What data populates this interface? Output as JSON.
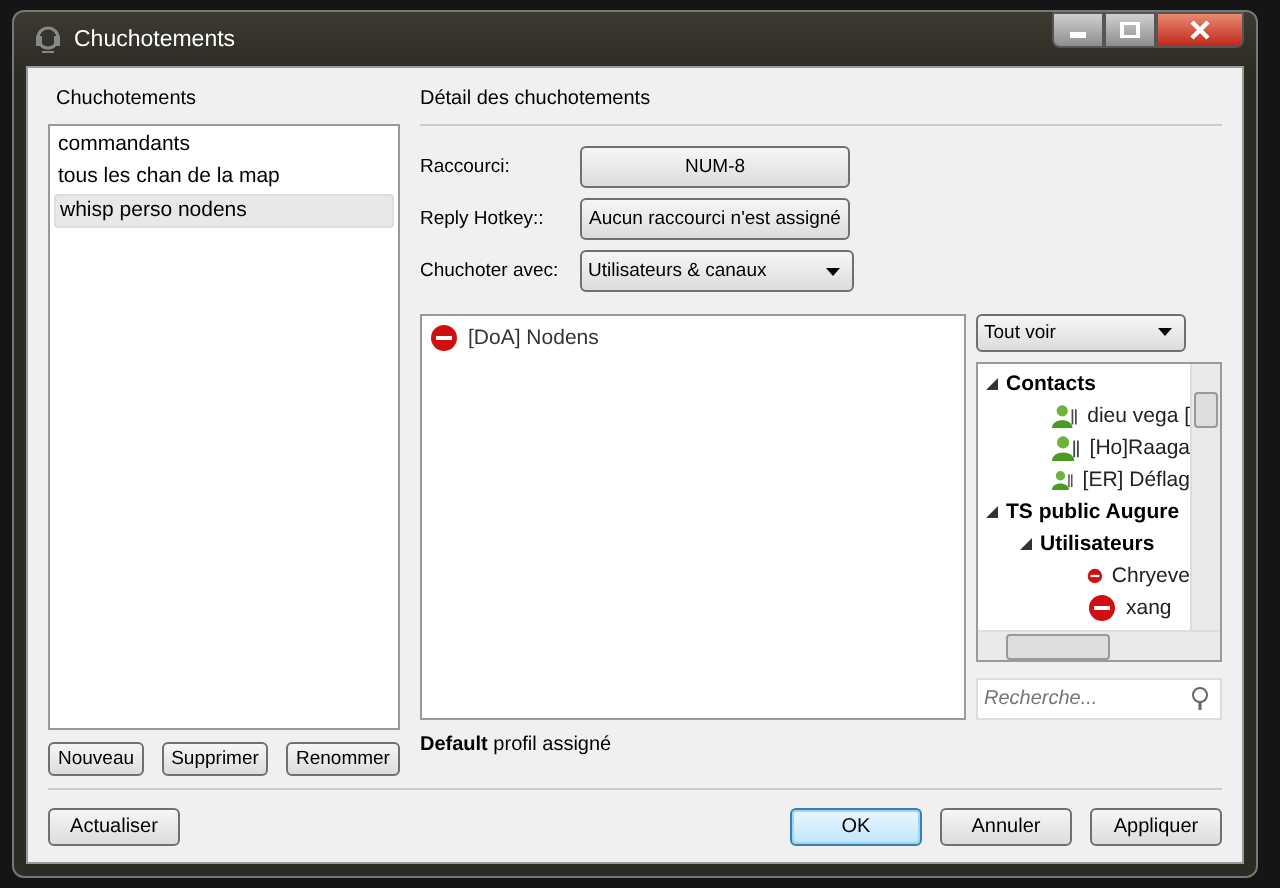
{
  "window": {
    "title": "Chuchotements"
  },
  "whisper_list": {
    "heading": "Chuchotements",
    "items": [
      {
        "label": "commandants",
        "selected": false
      },
      {
        "label": "tous les chan de la map",
        "selected": false
      },
      {
        "label": "whisp perso nodens",
        "selected": true
      }
    ],
    "buttons": [
      "Nouveau",
      "Supprimer",
      "Renommer"
    ]
  },
  "details": {
    "heading": "Détail des chuchotements",
    "fields": [
      {
        "kind": "hotkey",
        "label": "Raccourci:",
        "value": "NUM-8"
      },
      {
        "kind": "hotkey",
        "label": "Reply Hotkey::",
        "value": "Aucun raccourci n'est assigné"
      },
      {
        "kind": "dropdown",
        "label": "Chuchoter avec:",
        "value": "Utilisateurs & canaux"
      }
    ],
    "targets": [
      {
        "name": "[DoA] Nodens",
        "color": "#d01010"
      }
    ],
    "filter": {
      "value": "Tout voir"
    },
    "tree": [
      {
        "kind": "group",
        "label": "Contacts",
        "expanded": true,
        "children": [
          {
            "kind": "contact",
            "label": "dieu vega ["
          },
          {
            "kind": "contact",
            "label": "[Ho]Raaga"
          },
          {
            "kind": "contact",
            "label": "[ER] Déflag"
          }
        ]
      },
      {
        "kind": "group",
        "label": "TS public Augure",
        "expanded": true,
        "children": [
          {
            "kind": "group",
            "label": "Utilisateurs",
            "expanded": true,
            "children": [
              {
                "kind": "user",
                "label": "Chryeve"
              },
              {
                "kind": "user",
                "label": "xang"
              }
            ]
          }
        ]
      }
    ],
    "search": {
      "placeholder": "Recherche..."
    },
    "profile": "**Default** profil assigné"
  },
  "footer": {
    "left": [
      {
        "label": "Actualiser",
        "default": false
      }
    ],
    "right": [
      {
        "label": "OK",
        "default": true
      },
      {
        "label": "Annuler",
        "default": false
      },
      {
        "label": "Appliquer",
        "default": false
      }
    ]
  }
}
